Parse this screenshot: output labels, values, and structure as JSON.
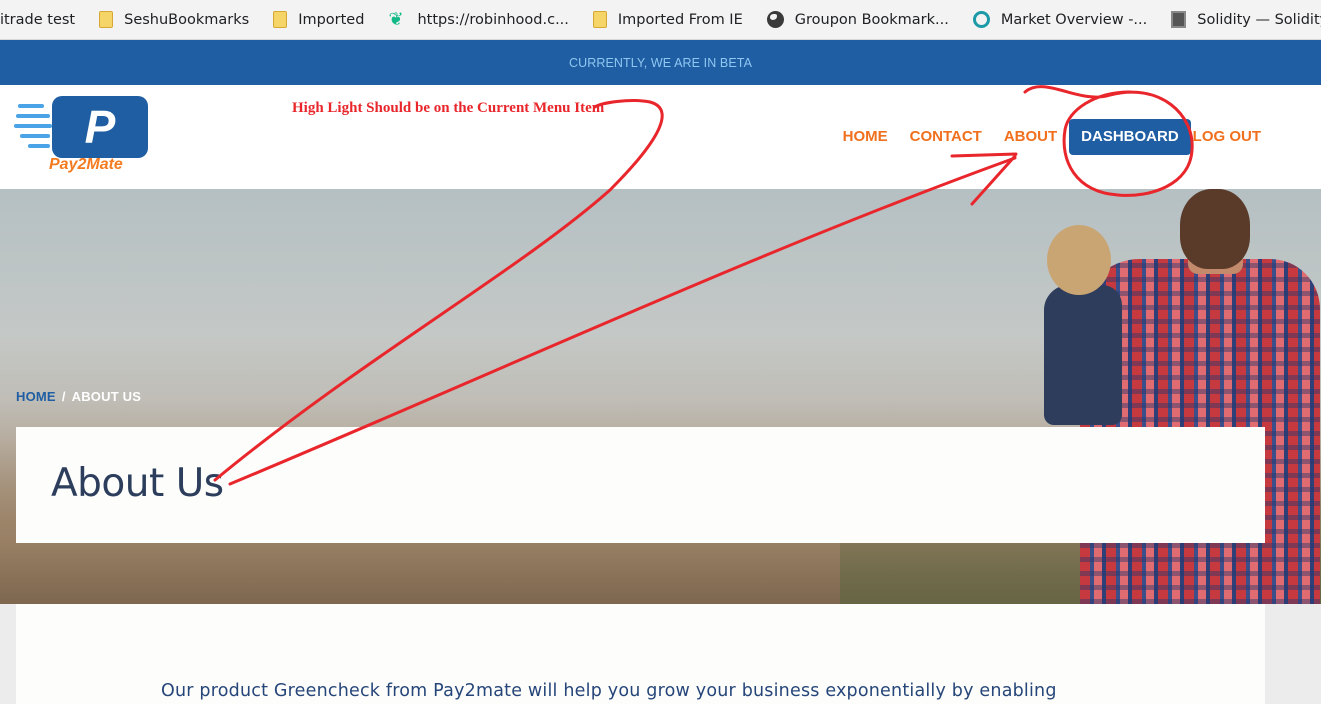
{
  "bookmarks": [
    {
      "label": "ritrade test",
      "icon": "none"
    },
    {
      "label": "SeshuBookmarks",
      "icon": "folder-icon"
    },
    {
      "label": "Imported",
      "icon": "folder-icon"
    },
    {
      "label": "https://robinhood.c...",
      "icon": "feather-icon"
    },
    {
      "label": "Imported From IE",
      "icon": "folder-icon"
    },
    {
      "label": "Groupon Bookmark...",
      "icon": "globe-icon"
    },
    {
      "label": "Market Overview -...",
      "icon": "market-icon"
    },
    {
      "label": "Solidity — Solidity...",
      "icon": "solidity-icon"
    }
  ],
  "beta_banner": "CURRENTLY, WE ARE IN BETA",
  "logo": {
    "letter": "P",
    "name": "Pay2Mate"
  },
  "annotation": "High Light Should be on the Current Menu Item",
  "nav": {
    "home": "HOME",
    "contact": "CONTACT",
    "about": "ABOUT",
    "dashboard": "DASHBOARD",
    "logout": "LOG OUT"
  },
  "breadcrumb": {
    "home": "HOME",
    "separator": "/",
    "current": "ABOUT US"
  },
  "page_title": "About Us",
  "intro_text": "Our product Greencheck from Pay2mate will help you grow your business exponentially by enabling",
  "colors": {
    "brand_blue": "#1f5ea3",
    "accent_orange": "#f0701d",
    "annotation_red": "#e8262b"
  }
}
